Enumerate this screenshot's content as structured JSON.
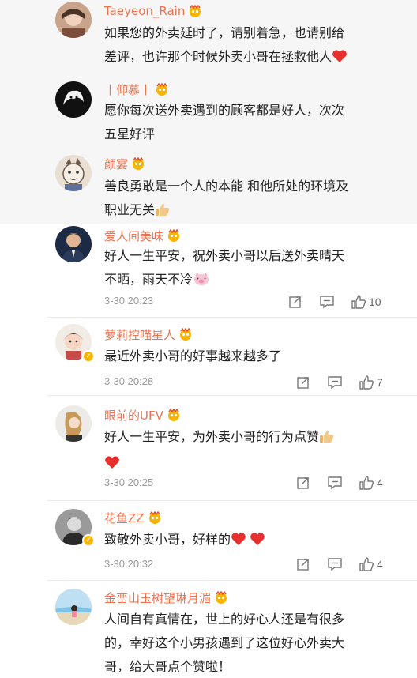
{
  "comments": [
    {
      "user": "Taeyeon_Rain",
      "text_lines": [
        "如果您的外卖延时了，请别着急，也请别给",
        "差评，也许那个时候外卖小哥在拯救他人"
      ],
      "trailing_emoji": "heart-icon"
    },
    {
      "user": "丨仰慕丨",
      "text_lines": [
        "愿你每次送外卖遇到的顾客都是好人，次次",
        "五星好评"
      ]
    },
    {
      "user": "颜宴",
      "text_lines": [
        "善良勇敢是一个人的本能 和他所处的环境及",
        "职业无关"
      ],
      "trailing_emoji": "thumbs-up-icon"
    },
    {
      "user": "爱人间美味",
      "text_lines": [
        "好人一生平安，祝外卖小哥以后送外卖晴天",
        "不晒，雨天不冷"
      ],
      "trailing_emoji": "pig-face-icon",
      "time": "3-30 20:23",
      "likes": "10"
    },
    {
      "user": "萝莉控喵星人",
      "text_lines": [
        "最近外卖小哥的好事越来越多了"
      ],
      "time": "3-30 20:28",
      "likes": "7"
    },
    {
      "user": "眼前的UFV",
      "text_lines": [
        "好人一生平安，为外卖小哥的行为点赞"
      ],
      "trailing_emoji": "thumbs-up-icon",
      "extra_emoji": "heart-icon",
      "time": "3-30 20:25",
      "likes": "4"
    },
    {
      "user": "花鱼ZZ",
      "text_lines": [
        "致敬外卖小哥，好样的"
      ],
      "trailing_emoji": "heart-icon",
      "time": "3-30 20:32",
      "likes": "4"
    },
    {
      "user": "金峦山玉树望琳月湄",
      "text_lines": [
        "人间自有真情在，世上的好心人还是有很多",
        "的，幸好这个小男孩遇到了这位好心外卖大",
        "哥，给大哥点个赞啦！"
      ]
    }
  ],
  "colors": {
    "username": "#eb7350",
    "body_text": "#222222",
    "meta_text": "#9a9a9a",
    "heart": "#e8302f",
    "verified_badge": "#f7b500"
  },
  "icons": {
    "vip_badge": "vip-crown-icon",
    "repost": "repost-icon",
    "comment": "comment-icon",
    "like": "like-icon"
  }
}
